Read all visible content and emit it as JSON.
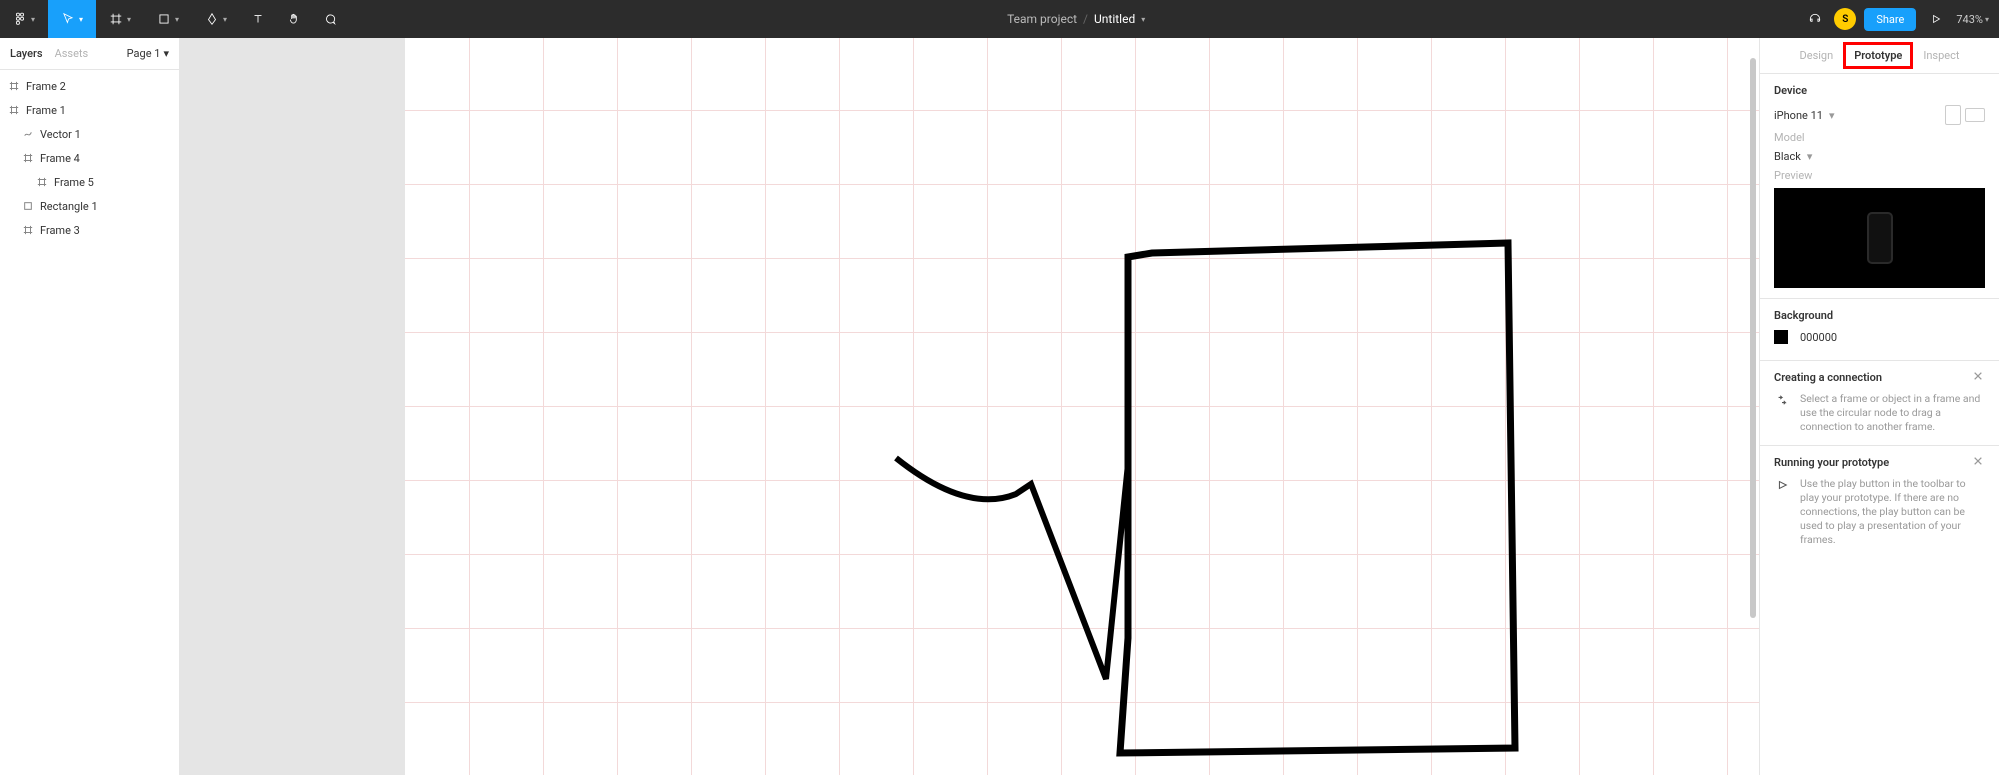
{
  "topbar": {
    "team": "Team project",
    "file": "Untitled",
    "avatar_letter": "S",
    "share_label": "Share",
    "zoom": "743%"
  },
  "left": {
    "tab_layers": "Layers",
    "tab_assets": "Assets",
    "page_label": "Page 1",
    "layers": [
      {
        "name": "Frame 2",
        "icon": "frame",
        "indent": 0
      },
      {
        "name": "Frame 1",
        "icon": "frame",
        "indent": 0
      },
      {
        "name": "Vector 1",
        "icon": "vector",
        "indent": 1
      },
      {
        "name": "Frame 4",
        "icon": "frame",
        "indent": 1
      },
      {
        "name": "Frame 5",
        "icon": "frame",
        "indent": 2
      },
      {
        "name": "Rectangle 1",
        "icon": "rect",
        "indent": 1
      },
      {
        "name": "Frame 3",
        "icon": "frame",
        "indent": 1
      }
    ]
  },
  "right": {
    "tab_design": "Design",
    "tab_prototype": "Prototype",
    "tab_inspect": "Inspect",
    "device_title": "Device",
    "device_value": "iPhone 11",
    "model_label": "Model",
    "model_value": "Black",
    "preview_label": "Preview",
    "background_title": "Background",
    "background_value": "000000",
    "help1_title": "Creating a connection",
    "help1_body": "Select a frame or object in a frame and use the circular node to drag a connection to another frame.",
    "help2_title": "Running your prototype",
    "help2_body": "Use the play button in the toolbar to play your prototype. If there are no connections, the play button can be used to play a presentation of your frames."
  }
}
